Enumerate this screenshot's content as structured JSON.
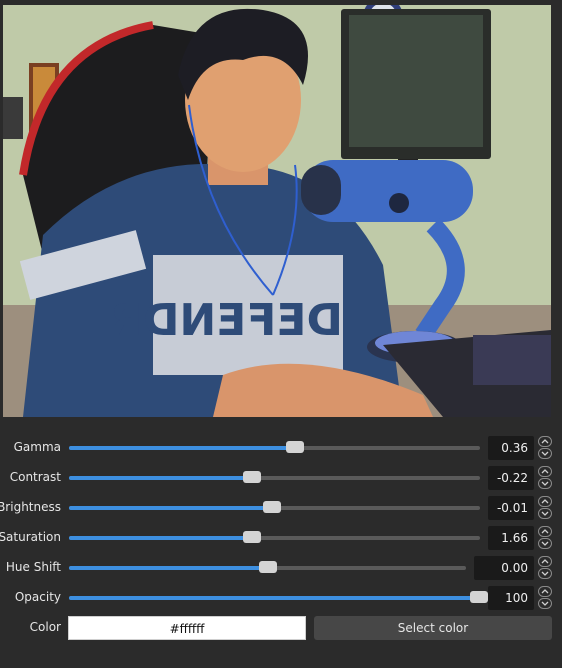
{
  "controls": [
    {
      "id": "gamma",
      "label": "Gamma",
      "value": "0.36",
      "level": 0.55
    },
    {
      "id": "contrast",
      "label": "Contrast",
      "value": "-0.22",
      "level": 0.445
    },
    {
      "id": "brightness",
      "label": "Brightness",
      "value": "-0.01",
      "level": 0.495
    },
    {
      "id": "saturation",
      "label": "Saturation",
      "value": "1.66",
      "level": 0.445
    },
    {
      "id": "hue-shift",
      "label": "Hue Shift",
      "value": "0.00",
      "level": 0.5
    },
    {
      "id": "opacity",
      "label": "Opacity",
      "value": "100",
      "level": 1.0
    }
  ],
  "color": {
    "label": "Color",
    "value": "#ffffff",
    "button_label": "Select color"
  },
  "colors": {
    "accent": "#3d8fe0",
    "background": "#2b2b2b"
  },
  "icons": {
    "spin_up": "chevron-up-icon",
    "spin_down": "chevron-down-icon"
  }
}
